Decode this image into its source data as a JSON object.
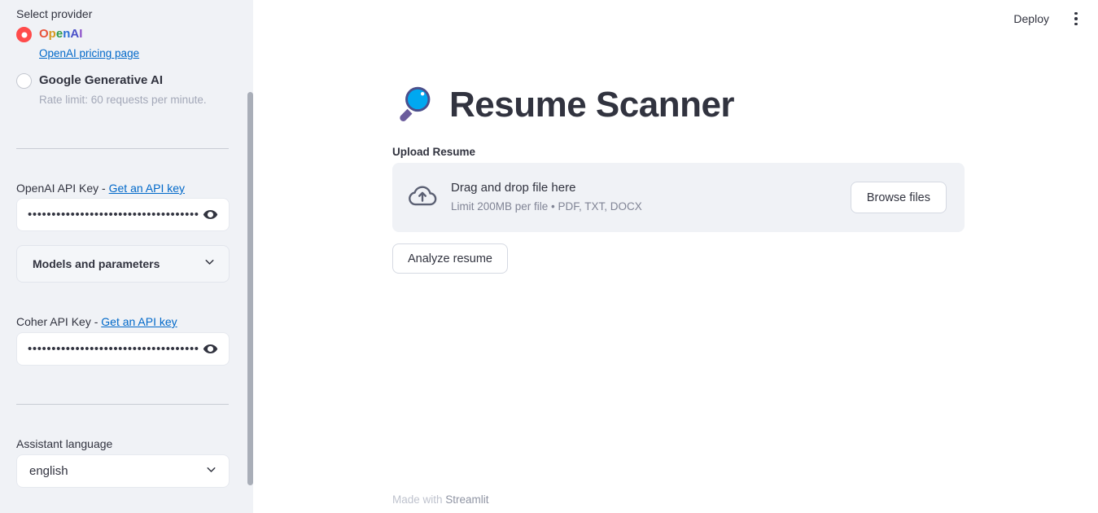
{
  "sidebar": {
    "select_provider_label": "Select provider",
    "providers": [
      {
        "label": "OpenAI",
        "selected": true,
        "link_text": "OpenAI pricing page",
        "rainbow": true,
        "rainbow_colors": [
          "#E8533A",
          "#D79A21",
          "#2E9A4B",
          "#2B6FD6",
          "#4B51C9",
          "#8B4FC9"
        ]
      },
      {
        "label": "Google Generative AI",
        "selected": false,
        "caption": "Rate limit: 60 requests per minute."
      }
    ],
    "openai_key": {
      "label_prefix": "OpenAI API Key - ",
      "label_link": "Get an API key",
      "value_masked": "•••••••••••••••••••••••••••••••••••••••••••••",
      "toggle_icon": "eye-icon"
    },
    "models_expander": {
      "label": "Models and parameters",
      "icon": "chevron-down-icon",
      "expanded": false
    },
    "coher_key": {
      "label_prefix": "Coher API Key - ",
      "label_link": "Get an API key",
      "value_masked": "•••••••••••••••••••••••••••••••••••••••••••••",
      "toggle_icon": "eye-icon"
    },
    "assistant_language": {
      "label": "Assistant language",
      "value": "english",
      "icon": "chevron-down-icon"
    }
  },
  "topbar": {
    "deploy_label": "Deploy",
    "more_menu_icon": "more-vertical-icon"
  },
  "main": {
    "title_emoji": "magnifying-glass-icon",
    "title": "Resume Scanner",
    "upload_label": "Upload Resume",
    "uploader": {
      "icon": "cloud-upload-icon",
      "dropzone_title": "Drag and drop file here",
      "dropzone_hint": "Limit 200MB per file • PDF, TXT, DOCX",
      "browse_label": "Browse files"
    },
    "analyze_label": "Analyze resume"
  },
  "footer": {
    "made_with": "Made with ",
    "brand": "Streamlit"
  },
  "colors": {
    "sidebar_bg": "#F0F2F6",
    "main_bg": "#FFFFFF",
    "text": "#31333F",
    "link": "#0068C9",
    "accent_red": "#FF4B4B",
    "muted": "#808495"
  }
}
